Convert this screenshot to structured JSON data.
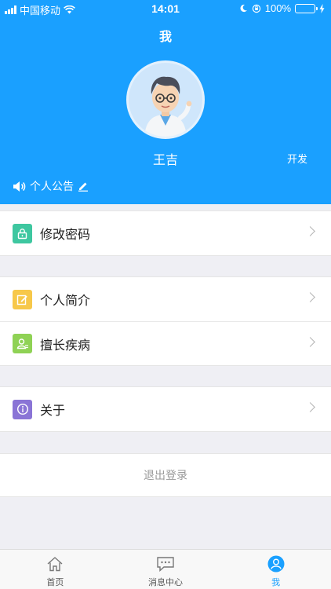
{
  "status_bar": {
    "carrier": "中国移动",
    "time": "14:01",
    "battery": "100%"
  },
  "header": {
    "title": "我",
    "user_name": "王吉",
    "role": "开发",
    "announcement_label": "个人公告"
  },
  "menu": {
    "change_password": "修改密码",
    "profile": "个人简介",
    "specialty": "擅长疾病",
    "about": "关于"
  },
  "logout_label": "退出登录",
  "tabbar": {
    "home": "首页",
    "messages": "消息中心",
    "me": "我"
  },
  "colors": {
    "primary": "#1aa0ff",
    "password_icon": "#3ec7a0",
    "profile_icon": "#f7c84a",
    "specialty_icon": "#8fd255",
    "about_icon": "#8a74d6"
  }
}
